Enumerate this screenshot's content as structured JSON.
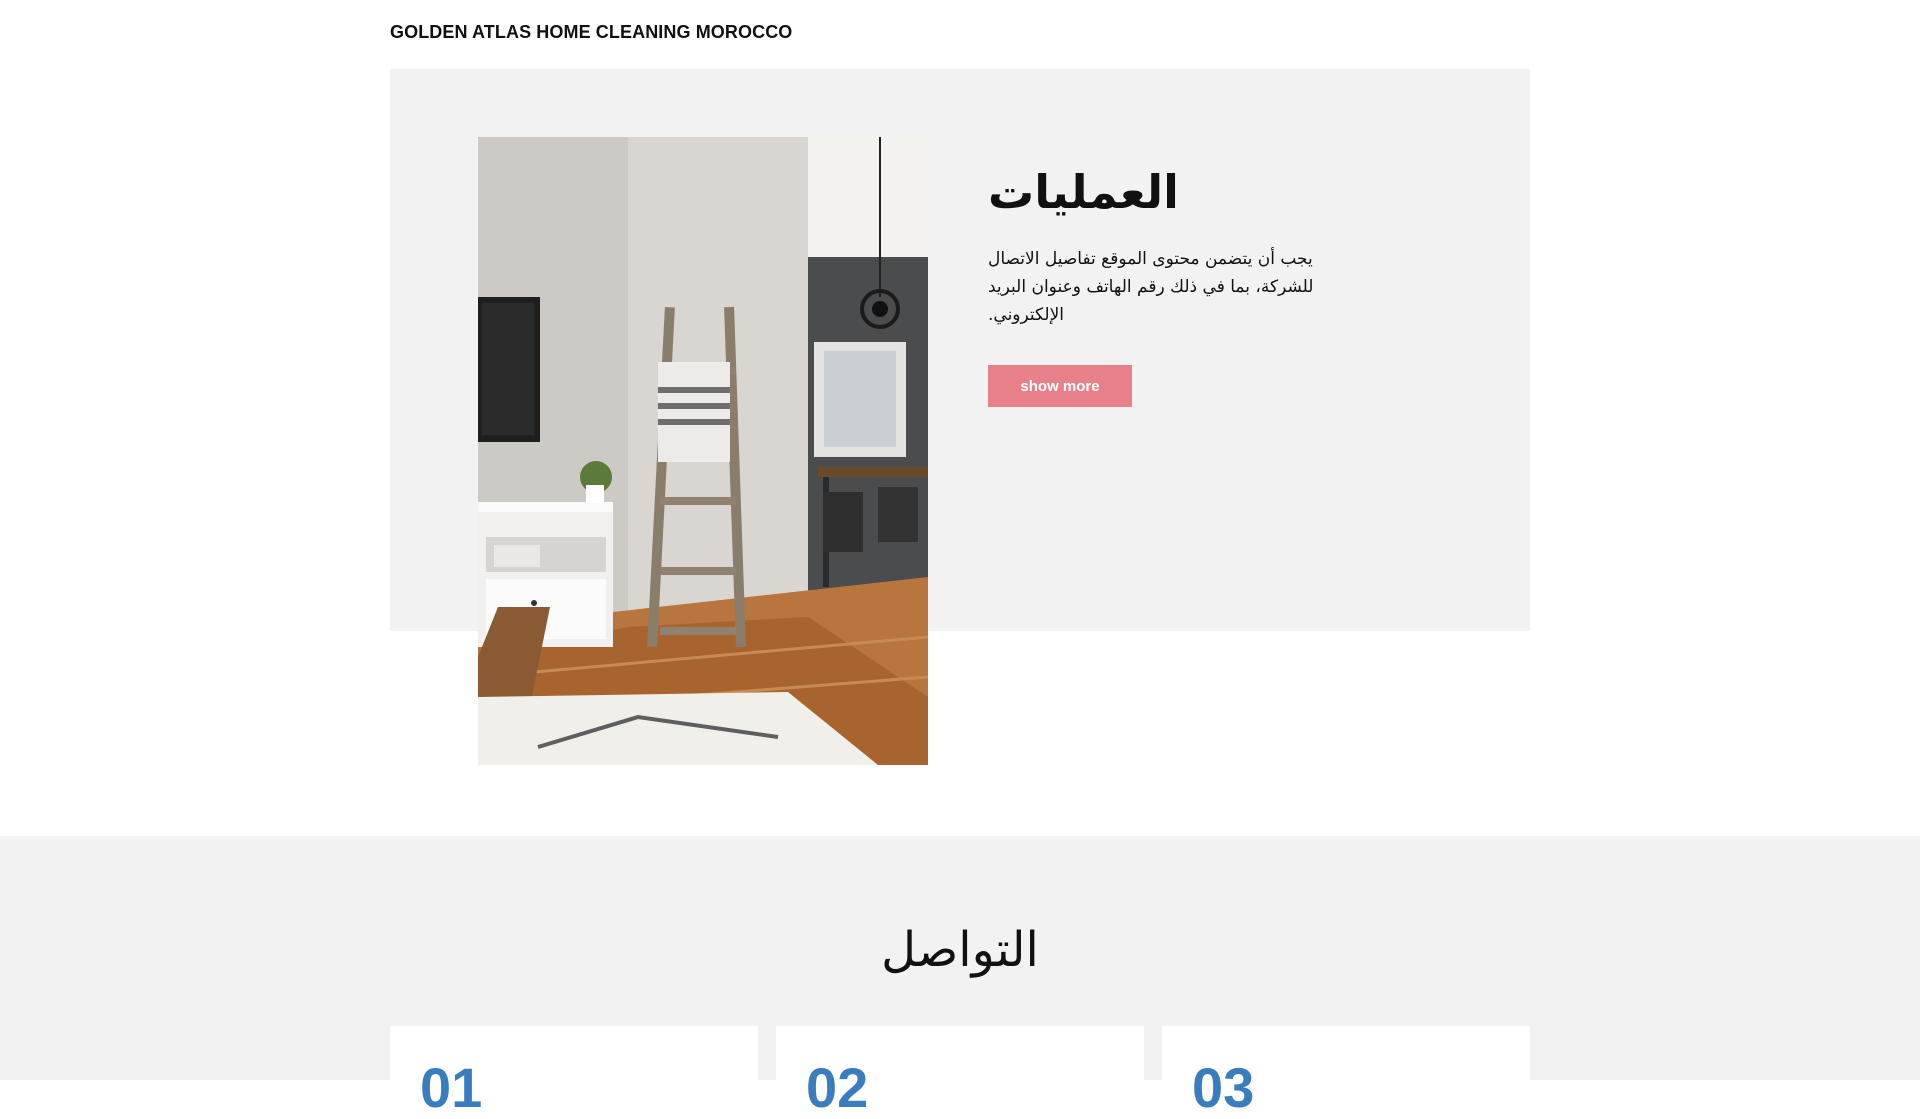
{
  "header": {
    "brand": "GOLDEN ATLAS HOME CLEANING MOROCCO"
  },
  "hero": {
    "image_alt": "Bright living room with wooden ladder, towel, white cabinet and shaggy rug",
    "title": "العمليات",
    "description": "يجب أن يتضمن محتوى الموقع تفاصيل الاتصال للشركة، بما في ذلك رقم الهاتف وعنوان البريد الإلكتروني.",
    "button_label": "show more"
  },
  "contact": {
    "title": "التواصل",
    "cards": [
      {
        "number": "01"
      },
      {
        "number": "02"
      },
      {
        "number": "03"
      }
    ]
  },
  "colors": {
    "button_bg": "#e8808a",
    "number_accent": "#3a7dbf",
    "section_bg": "#f2f2f2"
  }
}
